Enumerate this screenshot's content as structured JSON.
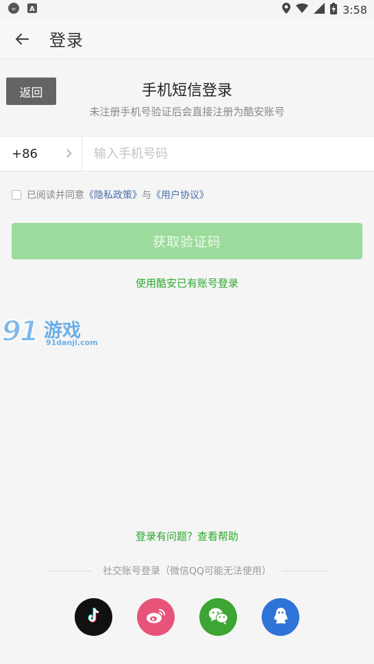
{
  "status_bar": {
    "time": "3:58",
    "left_icons": [
      "infinity-icon",
      "a-badge-icon"
    ],
    "right_icons": [
      "location-icon",
      "wifi-icon",
      "signal-icon",
      "battery-charging-icon"
    ]
  },
  "app_bar": {
    "title": "登录",
    "back_icon": "back-arrow-icon"
  },
  "return_button": {
    "label": "返回"
  },
  "login": {
    "title": "手机短信登录",
    "subtitle": "未注册手机号验证后会直接注册为酷安账号",
    "country_code": "+86",
    "phone_placeholder": "输入手机号码",
    "phone_value": "",
    "agreement": {
      "prefix": "已阅读并同意",
      "privacy": "《隐私政策》",
      "conjunction": "与",
      "terms": "《用户协议》",
      "checked": false
    },
    "get_code_label": "获取验证码",
    "coolapk_login_label": "使用酷安已有账号登录"
  },
  "watermark": {
    "numerals": "91",
    "cn_text": "游戏",
    "domain": "91danji.com"
  },
  "help": {
    "label": "登录有问题？查看帮助"
  },
  "social": {
    "label": "社交账号登录（微信QQ可能无法使用）",
    "items": [
      {
        "name": "douyin",
        "icon": "tiktok-icon",
        "color": "#111111"
      },
      {
        "name": "weibo",
        "icon": "weibo-icon",
        "color": "#e8537a"
      },
      {
        "name": "wechat",
        "icon": "wechat-icon",
        "color": "#3ca534"
      },
      {
        "name": "qq",
        "icon": "qq-icon",
        "color": "#2f73d8"
      }
    ]
  },
  "colors": {
    "accent_green": "#2aa82a",
    "button_disabled": "#9cdb9b",
    "link_blue": "#4a6ea9"
  }
}
